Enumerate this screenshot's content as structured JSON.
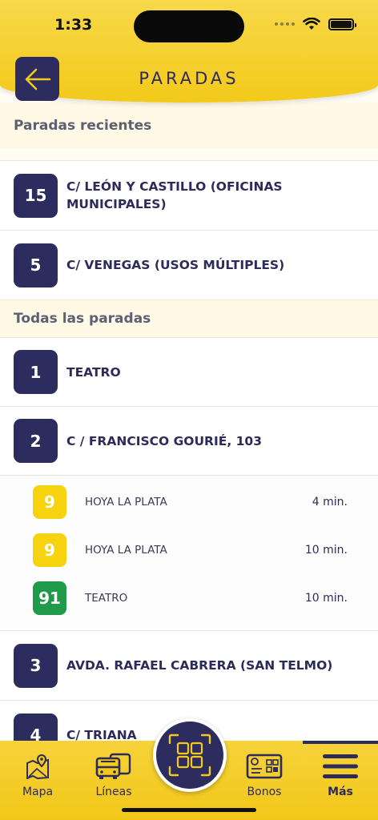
{
  "status": {
    "time": "1:33"
  },
  "header": {
    "title": "PARADAS"
  },
  "sections": {
    "recent": "Paradas recientes",
    "all": "Todas las paradas"
  },
  "recent_stops": [
    {
      "number": "15",
      "name": "C/ LEÓN Y CASTILLO (OFICINAS MUNICIPALES)"
    },
    {
      "number": "5",
      "name": "C/ VENEGAS (USOS MÚLTIPLES)"
    }
  ],
  "all_stops": [
    {
      "number": "1",
      "name": "TEATRO"
    },
    {
      "number": "2",
      "name": "C / FRANCISCO GOURIÉ, 103"
    },
    {
      "number": "3",
      "name": "AVDA. RAFAEL CABRERA (SAN TELMO)"
    },
    {
      "number": "4",
      "name": "C/ TRIANA"
    }
  ],
  "arrivals": [
    {
      "line": "9",
      "destination": "HOYA LA PLATA",
      "time": "4 min.",
      "color": "#f6d20f"
    },
    {
      "line": "9",
      "destination": "HOYA LA PLATA",
      "time": "10 min.",
      "color": "#f6d20f"
    },
    {
      "line": "91",
      "destination": "TEATRO",
      "time": "10 min.",
      "color": "#1e9a4a"
    }
  ],
  "tabs": {
    "mapa": "Mapa",
    "lineas": "Líneas",
    "bonos": "Bonos",
    "mas": "Más"
  },
  "colors": {
    "navy": "#2d2c5f",
    "yellow": "#f3ca1a",
    "line_yellow": "#f6d20f",
    "line_green": "#1e9a4a"
  }
}
